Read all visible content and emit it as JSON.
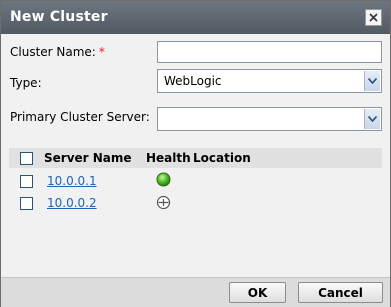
{
  "dialog": {
    "title": "New Cluster",
    "close_icon": "close-icon"
  },
  "form": {
    "cluster_name_label": "Cluster Name:",
    "required_marker": "*",
    "cluster_name_value": "",
    "type_label": "Type:",
    "type_value": "WebLogic",
    "primary_server_label": "Primary Cluster Server:",
    "primary_server_value": ""
  },
  "table": {
    "headers": {
      "server_name": "Server Name",
      "health": "Health",
      "location": "Location"
    },
    "rows": [
      {
        "server": "10.0.0.1",
        "health_icon": "health-ok-icon",
        "location": "",
        "checked": false
      },
      {
        "server": "10.0.0.2",
        "health_icon": "health-unknown-icon",
        "location": "",
        "checked": false
      }
    ]
  },
  "footer": {
    "ok_label": "OK",
    "cancel_label": "Cancel"
  },
  "colors": {
    "titlebar": "#5f6770",
    "link": "#1f63b8",
    "required": "#e2242e"
  }
}
